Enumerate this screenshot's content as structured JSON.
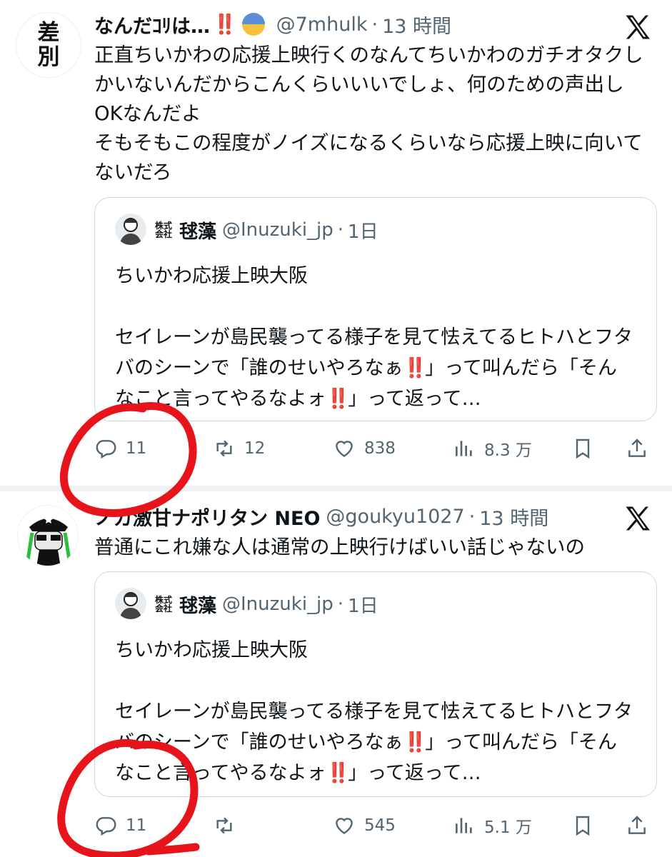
{
  "tweets": [
    {
      "display_name": "なんだｺﾘは…",
      "emoji_bang": "‼️",
      "handle": "@7mhulk",
      "time": "13 時間",
      "avatar_text": [
        "差",
        "別"
      ],
      "text": "正直ちいかわの応援上映行くのなんてちいかわのガチオタクしかいないんだからこんくらいいいでしょ、何のための声出しOKなんだよ\nそもそもこの程度がノイズになるくらいなら応援上映に向いてないだろ",
      "quote": {
        "display_name": "毬藻",
        "name_prefix": "株式会社",
        "handle": "@Inuzuki_jp",
        "time": "1日",
        "line1": "ちいかわ応援上映大阪",
        "line2a": "セイレーンが島民襲ってる様子を見て怯えてるヒトハとフタバのシーンで「誰のせいやろなぁ",
        "bang": "‼️",
        "line2b": "」って叫んだら「そんなこと言ってやるなよォ",
        "line2c": "」って返って…"
      },
      "stats": {
        "replies": "11",
        "retweets": "12",
        "likes": "838",
        "views": "8.3 万"
      }
    },
    {
      "display_name": "ノガ激甘ナポリタン NEO",
      "handle": "@goukyu1027",
      "time": "13 時間",
      "text": "普通にこれ嫌な人は通常の上映行けばいい話じゃないの",
      "quote": {
        "display_name": "毬藻",
        "name_prefix": "株式会社",
        "handle": "@Inuzuki_jp",
        "time": "1日",
        "line1": "ちいかわ応援上映大阪",
        "line2a": "セイレーンが島民襲ってる様子を見て怯えてるヒトハとフタバのシーンで「誰のせいやろなぁ",
        "bang": "‼️",
        "line2b": "」って叫んだら「そんなこと言ってやるなよォ",
        "line2c": "」って返って…"
      },
      "stats": {
        "replies": "11",
        "retweets": "",
        "likes": "545",
        "views": "5.1 万"
      }
    }
  ],
  "dot": "·",
  "colors": {
    "text": "#0f1419",
    "secondary": "#536471",
    "border": "#cfd9de",
    "annotation_red": "#e8141b",
    "bang_red": "#e0241b"
  },
  "icons": [
    "x-logo-icon",
    "reply-icon",
    "retweet-icon",
    "like-icon",
    "views-icon",
    "bookmark-icon",
    "share-icon"
  ]
}
